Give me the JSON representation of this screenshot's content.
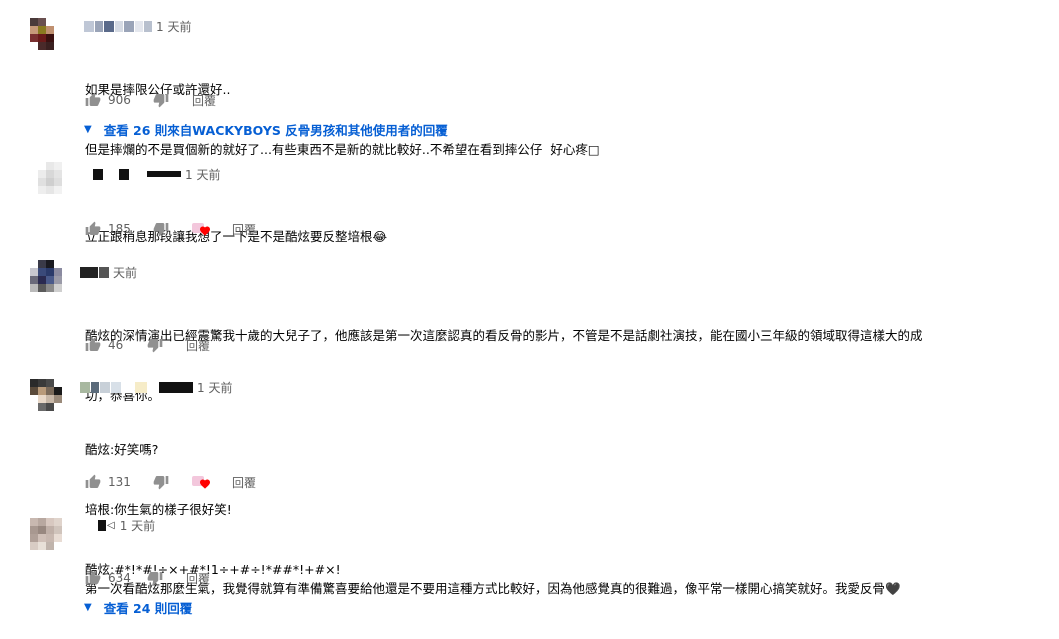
{
  "colors": {
    "link": "#065fd4",
    "meta": "#606060",
    "text": "#030303",
    "heart": "#ff0000"
  },
  "icons": {
    "like": "thumb-up-icon",
    "dislike": "thumb-down-icon",
    "expand": "caret-down-icon",
    "creator_heart": "creator-heart-icon"
  },
  "comments": [
    {
      "time": "1 天前",
      "lines": [
        "如果是摔限公仔或許還好..",
        "但是摔爛的不是買個新的就好了...有些東西不是新的就比較好..不希望在看到摔公仔  好心疼□"
      ],
      "likes": "906",
      "reply_label": "回覆",
      "view_replies": "查看 26 則來自WACKYBOYS 反骨男孩和其他使用者的回覆"
    },
    {
      "time": "1 天前",
      "lines": [
        "立正跟稍息那段讓我想了一下是不是酷炫要反整培根😂"
      ],
      "likes": "185",
      "reply_label": "回覆"
    },
    {
      "time": "天前",
      "lines": [
        "酷炫的深情演出已經震驚我十歲的大兒子了，他應該是第一次這麼認真的看反骨的影片，不管是不是話劇社演技，能在國小三年級的領域取得這樣大的成",
        "功，恭喜你。"
      ],
      "likes": "46",
      "reply_label": "回覆"
    },
    {
      "time": "1 天前",
      "lines": [
        "酷炫:好笑嗎?",
        "培根:你生氣的樣子很好笑!",
        "酷炫:#*!*#!÷×+#*!1÷+#÷!*##*!+#×!"
      ],
      "likes": "131",
      "reply_label": "回覆"
    },
    {
      "time": "1 天前",
      "lines": [
        "第一次看酷炫那麼生氣，我覺得就算有準備驚喜要給他還是不要用這種方式比較好，因為他感覺真的很難過，像平常一樣開心搞笑就好。我愛反骨🖤"
      ],
      "likes": "634",
      "reply_label": "回覆",
      "view_replies": "查看 24 則回覆"
    }
  ]
}
